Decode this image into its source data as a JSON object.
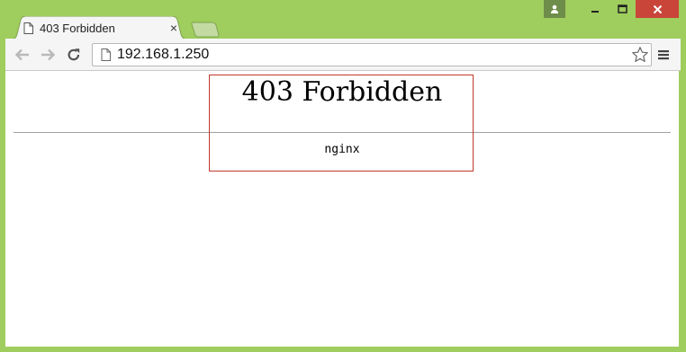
{
  "tab": {
    "title": "403 Forbidden",
    "close_glyph": "×"
  },
  "address_bar": {
    "url": "192.168.1.250"
  },
  "page": {
    "heading": "403 Forbidden",
    "server": "nginx"
  },
  "icons": {
    "user": "user-icon",
    "minimize": "minimize-icon",
    "maximize": "maximize-icon",
    "close": "close-icon",
    "back": "back-arrow-icon",
    "forward": "forward-arrow-icon",
    "reload": "reload-icon",
    "page": "page-icon",
    "star": "star-icon",
    "menu": "menu-icon"
  },
  "colors": {
    "frame": "#9fcd5e",
    "close_button": "#c9453a",
    "annotation_box": "#c0392b"
  }
}
